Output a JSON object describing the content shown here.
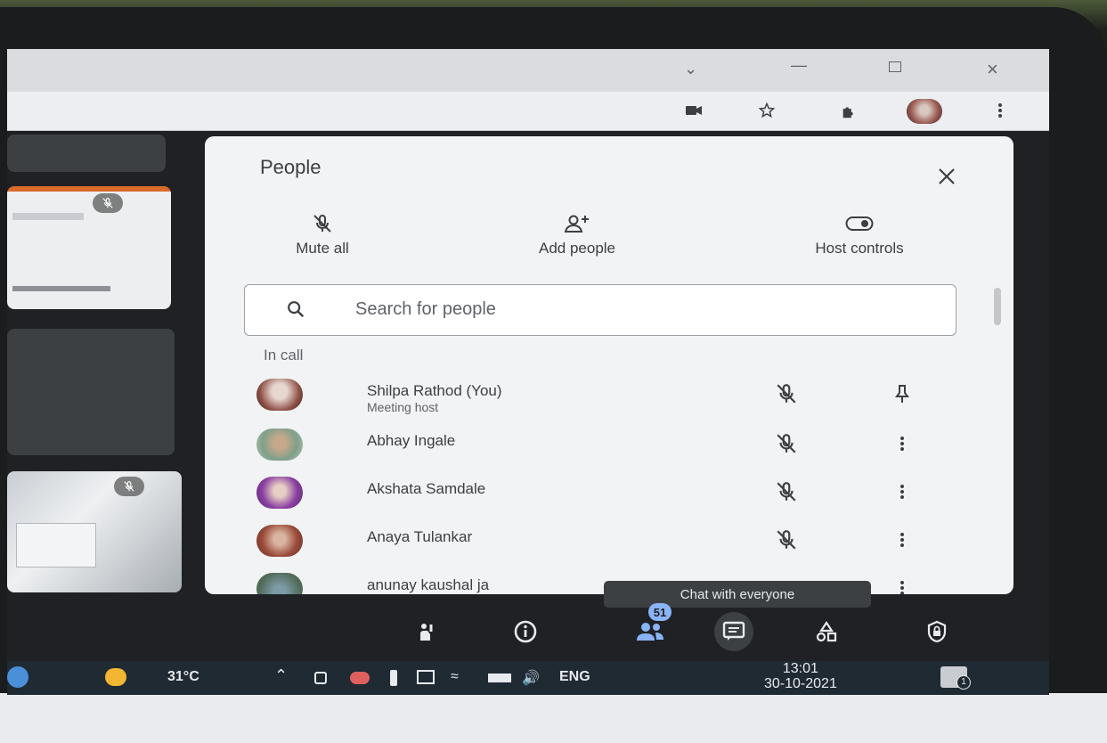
{
  "colors": {
    "accent": "#8ab4f8",
    "panel": "#f1f3f4",
    "stage": "#202124",
    "taskbar": "#1f2a33"
  },
  "browser": {
    "window_controls": [
      "chevron-down-icon",
      "minimize-icon",
      "restore-icon",
      "close-icon"
    ],
    "toolbar_icons": [
      "camera-icon",
      "star-icon",
      "extensions-icon",
      "profile-avatar",
      "more-vert-icon"
    ]
  },
  "people_panel": {
    "title": "People",
    "actions": [
      {
        "label": "Mute all",
        "icon": "mic-off-icon"
      },
      {
        "label": "Add people",
        "icon": "person-add-icon"
      },
      {
        "label": "Host controls",
        "icon": "toggle-icon"
      }
    ],
    "search_placeholder": "Search for people",
    "section_label": "In call",
    "participants": [
      {
        "name": "Shilpa Rathod (You)",
        "subtitle": "Meeting host",
        "trailing_icon": "pin-icon"
      },
      {
        "name": "Abhay Ingale",
        "subtitle": "",
        "trailing_icon": "more-vert-icon"
      },
      {
        "name": "Akshata Samdale",
        "subtitle": "",
        "trailing_icon": "more-vert-icon"
      },
      {
        "name": "Anaya Tulankar",
        "subtitle": "",
        "trailing_icon": "more-vert-icon"
      },
      {
        "name": "anunay kaushal ja",
        "subtitle": "",
        "trailing_icon": "more-vert-icon"
      }
    ]
  },
  "tooltip": "Chat with everyone",
  "controls": {
    "people_count": "51",
    "buttons": [
      "raise-hand-icon",
      "info-icon",
      "people-icon",
      "chat-icon",
      "activities-icon",
      "host-controls-icon"
    ]
  },
  "taskbar": {
    "weather": "31°C",
    "language": "ENG",
    "time": "13:01",
    "date": "30-10-2021",
    "notification_count": "1"
  }
}
